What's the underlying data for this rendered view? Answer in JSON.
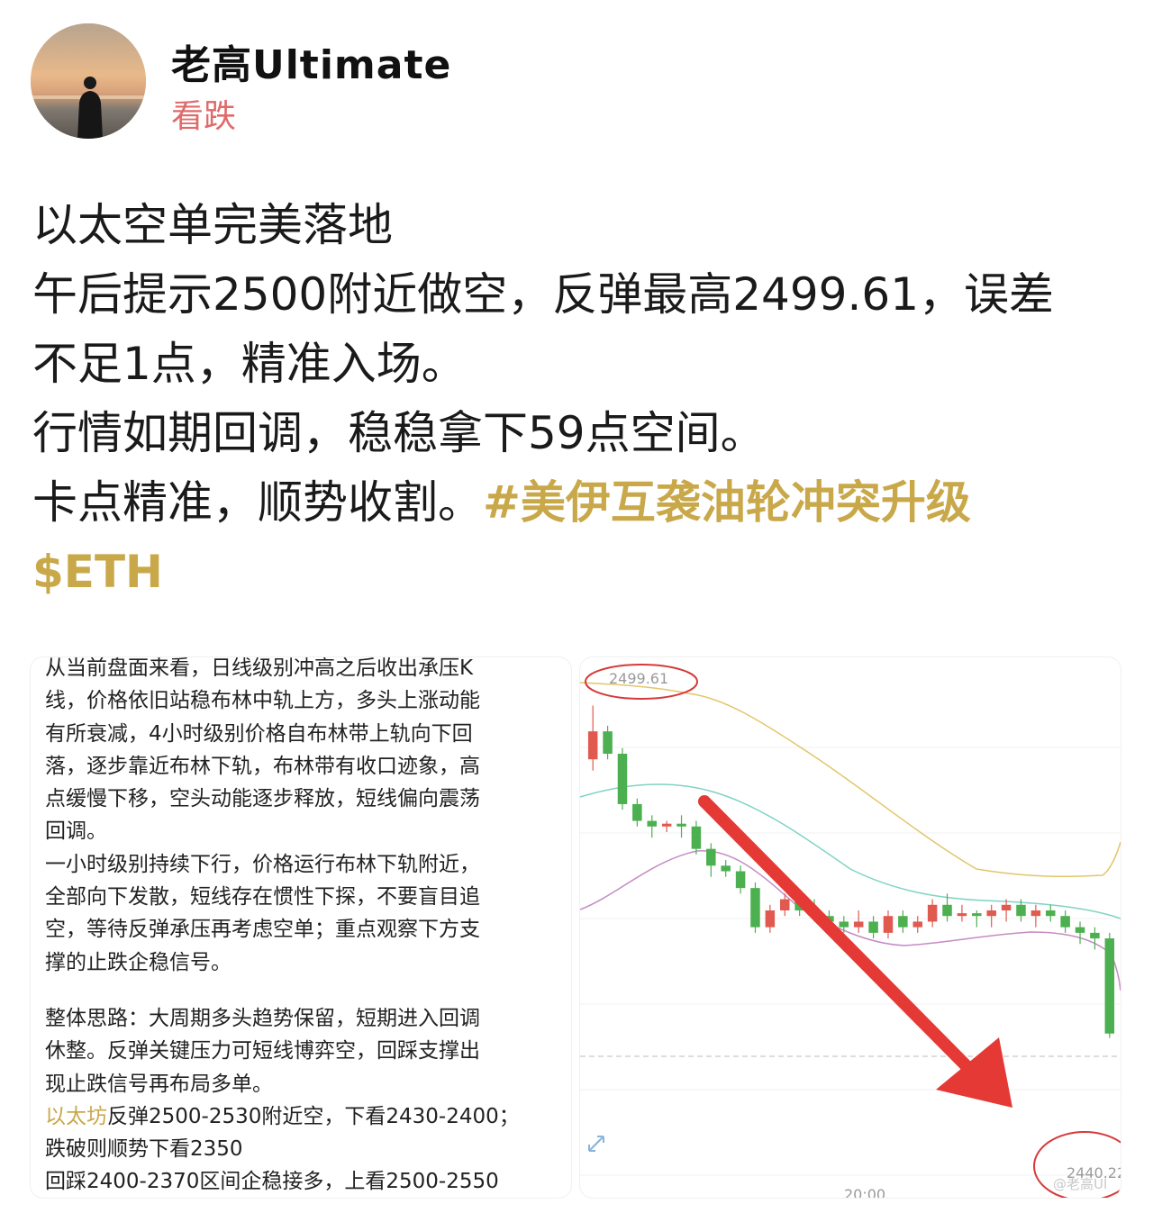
{
  "profile": {
    "username": "老高Ultimate",
    "sentiment": "看跌",
    "sentiment_color": "#e06a6a"
  },
  "post": {
    "lines": [
      "以太空单完美落地",
      "午后提示2500附近做空，反弹最高2499.61，误差",
      "不足1点，精准入场。",
      "行情如期回调，稳稳拿下59点空间。"
    ],
    "last_line_text": "卡点精准，顺势收割。",
    "hashtag": "#美伊互袭油轮冲突升级",
    "ticker": "$ETH",
    "accent_color": "#c9a84a"
  },
  "analysis_card": {
    "lines": [
      "从当前盘面来看，日线级别冲高之后收出承压K",
      "线，价格依旧站稳布林中轨上方，多头上涨动能",
      "有所衰减，4小时级别价格自布林带上轨向下回",
      "落，逐步靠近布林下轨，布林带有收口迹象，高",
      "点缓慢下移，空头动能逐步释放，短线偏向震荡",
      "回调。",
      "一小时级别持续下行，价格运行布林下轨附近，",
      "全部向下发散，短线存在惯性下探，不要盲目追",
      "空，等待反弹承压再考虑空单；重点观察下方支",
      "撑的止跌企稳信号。"
    ],
    "summary_lines": [
      "整体思路：大周期多头趋势保留，短期进入回调",
      "休整。反弹关键压力可短线博弈空，回踩支撑出",
      "现止跌信号再布局多单。"
    ],
    "eth_label": "以太坊",
    "eth_line_rest": "反弹2500-2530附近空，下看2430-2400；",
    "line_break_down": "跌破则顺势下看2350",
    "line_long": "回踩2400-2370区间企稳接多，上看2500-2550"
  },
  "chart_screenshot": {
    "high_label": "2499.61",
    "low_label": "2440.22",
    "time_label": "20:00",
    "watermark": "@老高Ul",
    "arrow_color": "#e53935",
    "up_color": "#e05a50",
    "down_color": "#4caf50"
  },
  "chart_data": {
    "type": "candlestick",
    "title": "",
    "xlabel": "",
    "ylabel": "",
    "x_tick_labels": [
      "20:00"
    ],
    "annotations": [
      "2499.61",
      "2440.22"
    ],
    "ylim": [
      2435,
      2505
    ],
    "candles": [
      {
        "open": 2490,
        "close": 2495,
        "high": 2499.61,
        "low": 2488
      },
      {
        "open": 2495,
        "close": 2491,
        "high": 2496,
        "low": 2490
      },
      {
        "open": 2491,
        "close": 2482,
        "high": 2492,
        "low": 2481
      },
      {
        "open": 2482,
        "close": 2479,
        "high": 2483,
        "low": 2478
      },
      {
        "open": 2479,
        "close": 2478,
        "high": 2480,
        "low": 2476
      },
      {
        "open": 2478,
        "close": 2478.5,
        "high": 2479,
        "low": 2477
      },
      {
        "open": 2478.5,
        "close": 2478,
        "high": 2480,
        "low": 2476
      },
      {
        "open": 2478,
        "close": 2474,
        "high": 2479,
        "low": 2473
      },
      {
        "open": 2474,
        "close": 2471,
        "high": 2475,
        "low": 2469
      },
      {
        "open": 2471,
        "close": 2470,
        "high": 2472,
        "low": 2469
      },
      {
        "open": 2470,
        "close": 2467,
        "high": 2471,
        "low": 2466
      },
      {
        "open": 2467,
        "close": 2460,
        "high": 2468,
        "low": 2459
      },
      {
        "open": 2460,
        "close": 2463,
        "high": 2464,
        "low": 2459
      },
      {
        "open": 2463,
        "close": 2465,
        "high": 2466,
        "low": 2462
      },
      {
        "open": 2465,
        "close": 2463,
        "high": 2466,
        "low": 2462
      },
      {
        "open": 2463,
        "close": 2462,
        "high": 2465,
        "low": 2461
      },
      {
        "open": 2462,
        "close": 2461,
        "high": 2463,
        "low": 2460
      },
      {
        "open": 2461,
        "close": 2460,
        "high": 2462,
        "low": 2459
      },
      {
        "open": 2460,
        "close": 2461,
        "high": 2463,
        "low": 2459
      },
      {
        "open": 2461,
        "close": 2459,
        "high": 2462,
        "low": 2458
      },
      {
        "open": 2459,
        "close": 2462,
        "high": 2463,
        "low": 2458
      },
      {
        "open": 2462,
        "close": 2460,
        "high": 2463,
        "low": 2459
      },
      {
        "open": 2460,
        "close": 2461,
        "high": 2462,
        "low": 2459
      },
      {
        "open": 2461,
        "close": 2464,
        "high": 2465,
        "low": 2460
      },
      {
        "open": 2464,
        "close": 2462,
        "high": 2466,
        "low": 2461
      },
      {
        "open": 2462,
        "close": 2462.5,
        "high": 2464,
        "low": 2461
      },
      {
        "open": 2462.5,
        "close": 2462,
        "high": 2463,
        "low": 2460
      },
      {
        "open": 2462,
        "close": 2463,
        "high": 2464,
        "low": 2460
      },
      {
        "open": 2463,
        "close": 2464,
        "high": 2465,
        "low": 2461
      },
      {
        "open": 2464,
        "close": 2462,
        "high": 2465,
        "low": 2461
      },
      {
        "open": 2462,
        "close": 2463,
        "high": 2464,
        "low": 2460
      },
      {
        "open": 2463,
        "close": 2462,
        "high": 2464,
        "low": 2461
      },
      {
        "open": 2462,
        "close": 2460,
        "high": 2463,
        "low": 2459
      },
      {
        "open": 2460,
        "close": 2459,
        "high": 2461,
        "low": 2457
      },
      {
        "open": 2459,
        "close": 2458,
        "high": 2460,
        "low": 2456
      },
      {
        "open": 2458,
        "close": 2441,
        "high": 2459,
        "low": 2440.22
      }
    ]
  }
}
